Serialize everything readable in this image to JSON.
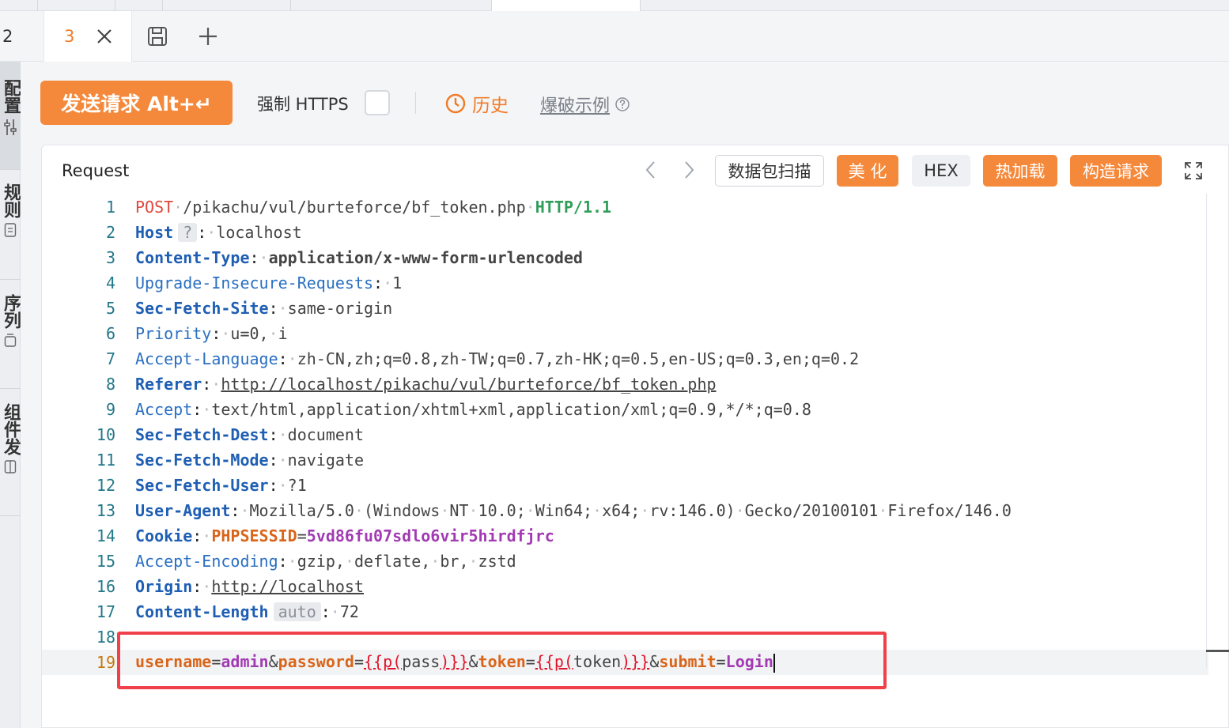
{
  "tabs": {
    "left_number": "2",
    "active_number": "3"
  },
  "sidebar": {
    "items": [
      "配置",
      "规则",
      "序列",
      "组件发"
    ]
  },
  "toolbar": {
    "send_label": "发送请求 Alt+↵",
    "force_https_label": "强制 HTTPS",
    "history_label": "历史",
    "example_label": "爆破示例"
  },
  "request": {
    "title": "Request",
    "buttons": {
      "scan": "数据包扫描",
      "beautify": "美 化",
      "hex": "HEX",
      "hotload": "热加载",
      "construct": "构造请求"
    },
    "lines": [
      {
        "n": "1"
      },
      {
        "n": "2"
      },
      {
        "n": "3"
      },
      {
        "n": "4"
      },
      {
        "n": "5"
      },
      {
        "n": "6"
      },
      {
        "n": "7"
      },
      {
        "n": "8"
      },
      {
        "n": "9"
      },
      {
        "n": "10"
      },
      {
        "n": "11"
      },
      {
        "n": "12"
      },
      {
        "n": "13"
      },
      {
        "n": "14"
      },
      {
        "n": "15"
      },
      {
        "n": "16"
      },
      {
        "n": "17"
      },
      {
        "n": "18"
      },
      {
        "n": "19"
      }
    ],
    "text": {
      "method": "POST",
      "path": "/pikachu/vul/burteforce/bf_token.php",
      "protocol": "HTTP/1.1",
      "host_key": "Host",
      "host_badge": "?",
      "host_val": "localhost",
      "ct_key": "Content-Type",
      "ct_val": "application/x-www-form-urlencoded",
      "uir_key": "Upgrade-Insecure-Requests",
      "uir_val": "1",
      "sfs_key": "Sec-Fetch-Site",
      "sfs_val": "same-origin",
      "pri_key": "Priority",
      "pri_val": "u=0, i",
      "al_key": "Accept-Language",
      "al_val": "zh-CN,zh;q=0.8,zh-TW;q=0.7,zh-HK;q=0.5,en-US;q=0.3,en;q=0.2",
      "ref_key": "Referer",
      "ref_val": "http://localhost/pikachu/vul/burteforce/bf_token.php",
      "acc_key": "Accept",
      "acc_val": "text/html,application/xhtml+xml,application/xml;q=0.9,*/*;q=0.8",
      "sfd_key": "Sec-Fetch-Dest",
      "sfd_val": "document",
      "sfm_key": "Sec-Fetch-Mode",
      "sfm_val": "navigate",
      "sfu_key": "Sec-Fetch-User",
      "sfu_val": "?1",
      "ua_key": "User-Agent",
      "ua_val": "Mozilla/5.0 (Windows NT 10.0; Win64; x64; rv:146.0) Gecko/20100101 Firefox/146.0",
      "cookie_key": "Cookie",
      "cookie_name": "PHPSESSID",
      "cookie_val": "5vd86fu07sdlo6vir5hirdfjrc",
      "ae_key": "Accept-Encoding",
      "ae_val": "gzip, deflate, br, zstd",
      "origin_key": "Origin",
      "origin_val": "http://localhost",
      "cl_key": "Content-Length",
      "cl_badge": "auto",
      "cl_val": "72",
      "body_username_key": "username",
      "body_username_val": "admin",
      "body_password_key": "password",
      "body_password_open": "{{p(",
      "body_password_var": "pass",
      "body_password_close": ")}}",
      "body_token_key": "token",
      "body_token_open": "{{p(",
      "body_token_var": "token",
      "body_token_close": ")}}",
      "body_submit_key": "submit",
      "body_submit_val": "Login"
    }
  }
}
